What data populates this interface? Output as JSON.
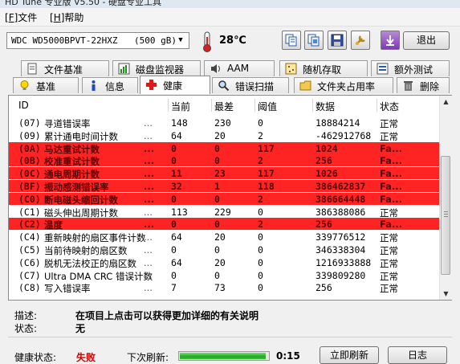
{
  "window": {
    "title_fragment": "HD Tune 专业版 V5.50 - 硬盘专业工具"
  },
  "menu": {
    "file": "文件",
    "file_key": "F",
    "help": "帮助",
    "help_key": "H"
  },
  "toolbar": {
    "drive_name": "WDC WD5000BPVT-22HXZ",
    "drive_size": "(500 gB)",
    "temperature": "28℃",
    "exit_label": "退出"
  },
  "tabs_top": [
    "文件基准",
    "磁盘监视器",
    "AAM",
    "随机存取",
    "额外测试"
  ],
  "tabs_bottom": [
    "基准",
    "信息",
    "健康",
    "错误扫描",
    "文件夹占用率",
    "删除"
  ],
  "table": {
    "headers": {
      "id": "ID",
      "current": "当前",
      "worst": "最差",
      "threshold": "阈值",
      "data": "数据",
      "status": "状态"
    },
    "rows": [
      {
        "code": "(07)",
        "name": "寻道错误率",
        "current": "148",
        "worst": "230",
        "threshold": "0",
        "data": "18884214",
        "status": "正常",
        "bad": false
      },
      {
        "code": "(09)",
        "name": "累计通电时间计数",
        "current": "64",
        "worst": "20",
        "threshold": "2",
        "data": "-462912768",
        "status": "正常",
        "bad": false
      },
      {
        "code": "(0A)",
        "name": "马达重试计数",
        "current": "0",
        "worst": "0",
        "threshold": "117",
        "data": "1024",
        "status": "Fa...",
        "bad": true
      },
      {
        "code": "(0B)",
        "name": "校准重试计数",
        "current": "0",
        "worst": "0",
        "threshold": "2",
        "data": "256",
        "status": "Fa...",
        "bad": true
      },
      {
        "code": "(0C)",
        "name": "通电周期计数",
        "current": "11",
        "worst": "23",
        "threshold": "117",
        "data": "1026",
        "status": "Fa...",
        "bad": true
      },
      {
        "code": "(BF)",
        "name": "振动感测错误率",
        "current": "32",
        "worst": "1",
        "threshold": "118",
        "data": "386462837",
        "status": "Fa...",
        "bad": true
      },
      {
        "code": "(C0)",
        "name": "断电磁头缩回计数",
        "current": "0",
        "worst": "0",
        "threshold": "2",
        "data": "386664448",
        "status": "Fa...",
        "bad": true
      },
      {
        "code": "(C1)",
        "name": "磁头伸出周期计数",
        "current": "113",
        "worst": "229",
        "threshold": "0",
        "data": "386388086",
        "status": "正常",
        "bad": false
      },
      {
        "code": "(C2)",
        "name": "温度",
        "current": "0",
        "worst": "0",
        "threshold": "2",
        "data": "256",
        "status": "Fa...",
        "bad": true
      },
      {
        "code": "(C4)",
        "name": "重新映射的扇区事件计数",
        "current": "64",
        "worst": "20",
        "threshold": "0",
        "data": "339776512",
        "status": "正常",
        "bad": false
      },
      {
        "code": "(C5)",
        "name": "当前待映射的扇区数",
        "current": "0",
        "worst": "0",
        "threshold": "0",
        "data": "346338304",
        "status": "正常",
        "bad": false
      },
      {
        "code": "(C6)",
        "name": "脱机无法校正的扇区数",
        "current": "64",
        "worst": "20",
        "threshold": "0",
        "data": "1216933888",
        "status": "正常",
        "bad": false
      },
      {
        "code": "(C7)",
        "name": "Ultra DMA CRC 错误计数",
        "current": "0",
        "worst": "0",
        "threshold": "0",
        "data": "339809280",
        "status": "正常",
        "bad": false
      },
      {
        "code": "(C8)",
        "name": "写入错误率",
        "current": "7",
        "worst": "73",
        "threshold": "0",
        "data": "256",
        "status": "正常",
        "bad": false
      }
    ]
  },
  "details": {
    "desc_label": "描述:",
    "desc_value": "在项目上点击可以获得更加详细的有关说明",
    "state_label": "状态:",
    "state_value": "无"
  },
  "footer": {
    "health_label": "健康状态:",
    "health_value": "失败",
    "refresh_label": "下次刷新:",
    "progress": 0.97,
    "countdown": "0:15",
    "refresh_now": "立即刷新",
    "log": "日志"
  },
  "colors": {
    "fail_row": "#ff2424",
    "fail_text": "#d00000",
    "progress": "#1fa91f"
  }
}
